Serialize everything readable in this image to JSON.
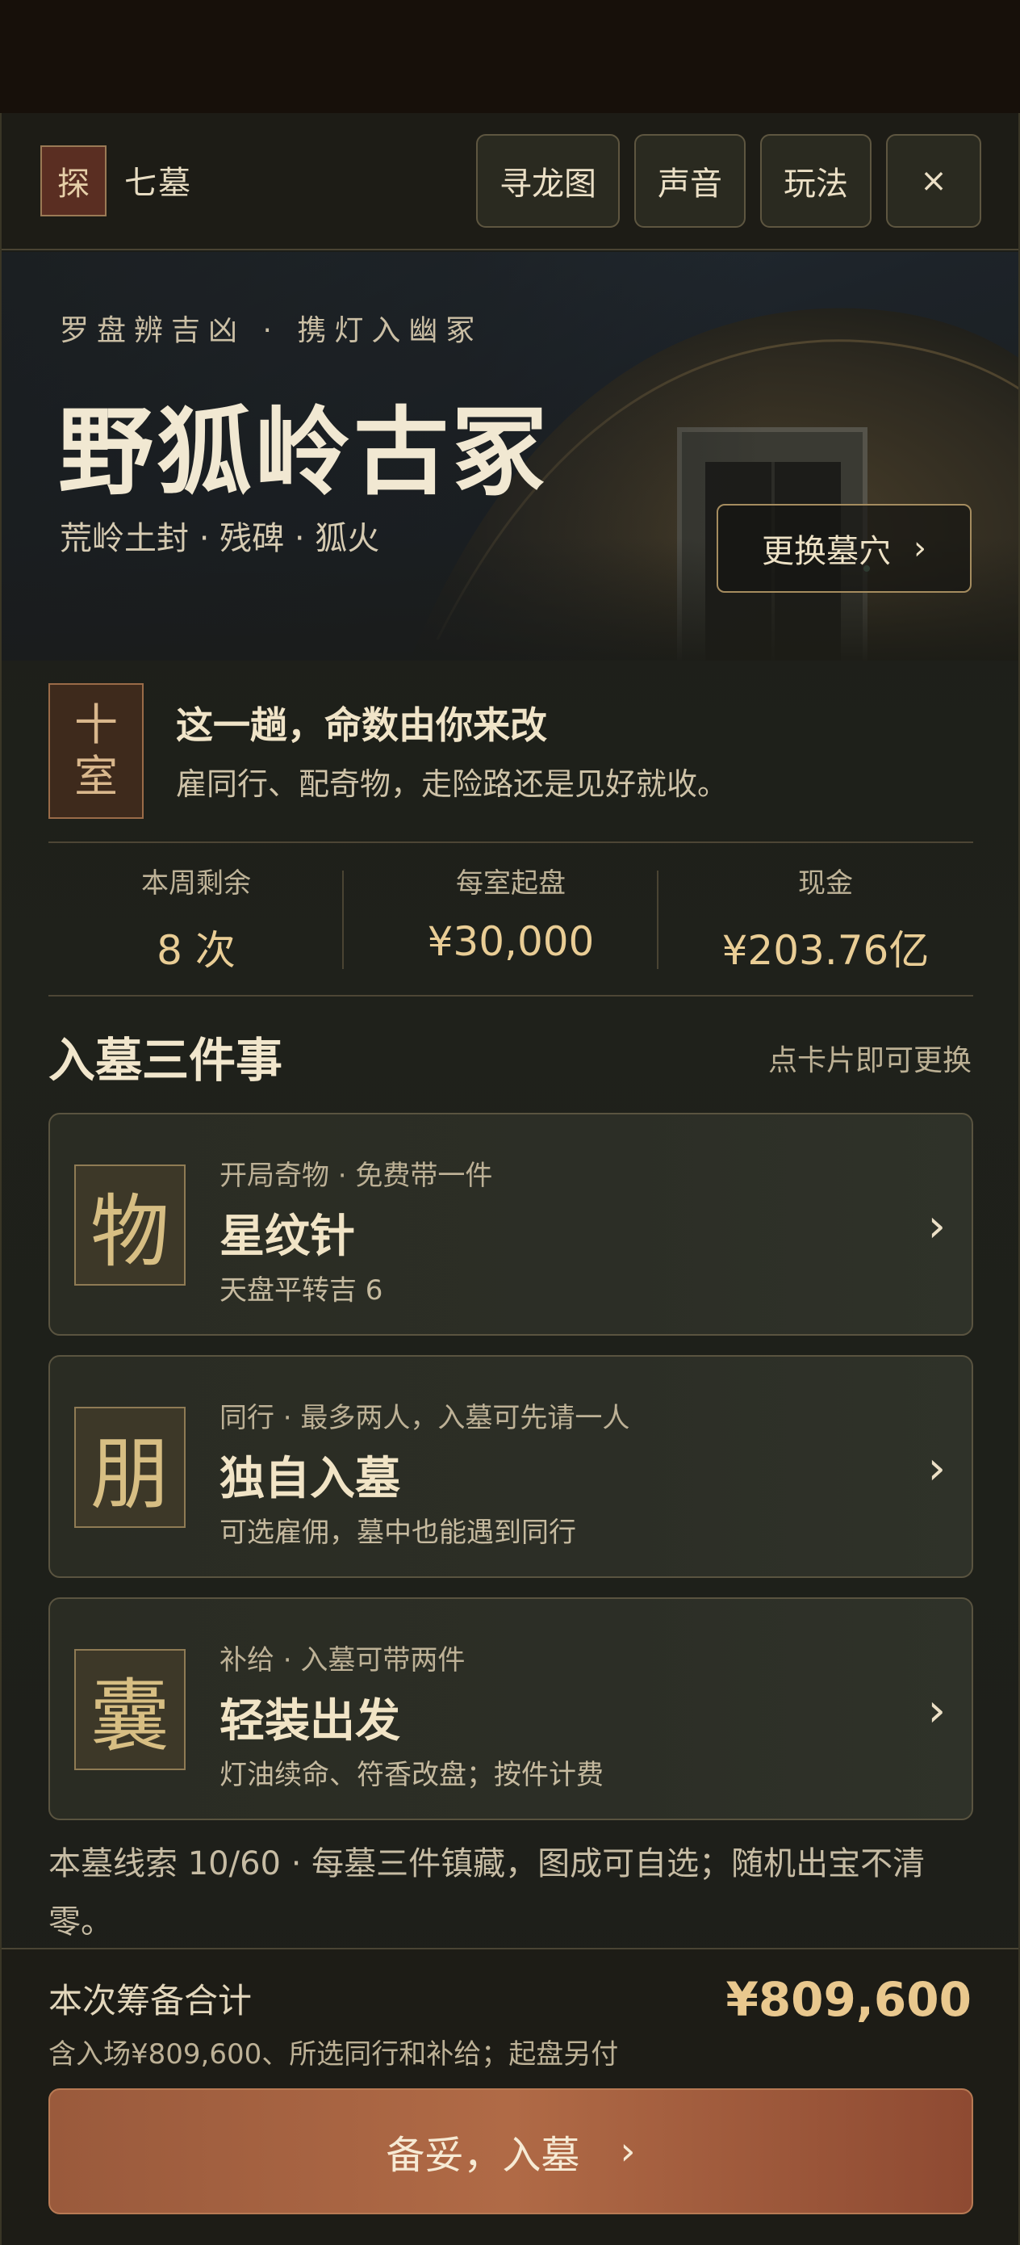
{
  "header": {
    "logo_char": "探",
    "brand": "七墓",
    "buttons": [
      "寻龙图",
      "声音",
      "玩法",
      "×"
    ]
  },
  "hero": {
    "tagline": "罗盘辨吉凶 · 携灯入幽冢",
    "title": "野狐岭古冢",
    "subtitle": "荒岭土封 · 残碑 · 狐火",
    "change_button": "更换墓穴",
    "change_chevron": "›"
  },
  "intro": {
    "room_chars": [
      "十",
      "室"
    ],
    "title": "这一趟，命数由你来改",
    "subtitle": "雇同行、配奇物，走险路还是见好就收。"
  },
  "stats": [
    {
      "label": "本周剩余",
      "value": "8 次"
    },
    {
      "label": "每室起盘",
      "value": "¥30,000"
    },
    {
      "label": "现金",
      "value": "¥203.76亿"
    }
  ],
  "section": {
    "title": "入墓三件事",
    "hint": "点卡片即可更换"
  },
  "cards": [
    {
      "icon_char": "物",
      "kicker": "开局奇物 · 免费带一件",
      "title": "星纹针",
      "desc": "天盘平转吉 6",
      "chevron": "›"
    },
    {
      "icon_char": "朋",
      "kicker": "同行 · 最多两人，入墓可先请一人",
      "title": "独自入墓",
      "desc": "可选雇佣，墓中也能遇到同行",
      "chevron": "›"
    },
    {
      "icon_char": "囊",
      "kicker": "补给 · 入墓可带两件",
      "title": "轻装出发",
      "desc": "灯油续命、符香改盘；按件计费",
      "chevron": "›"
    }
  ],
  "footnote": "本墓线索 10/60 · 每墓三件镇藏，图成可自选；随机出宝不清零。",
  "summary": {
    "label": "本次筹备合计",
    "desc": "含入场¥809,600、所选同行和补给；起盘另付",
    "value": "¥809,600",
    "cta": "备妥，入墓",
    "cta_chevron": "›"
  }
}
